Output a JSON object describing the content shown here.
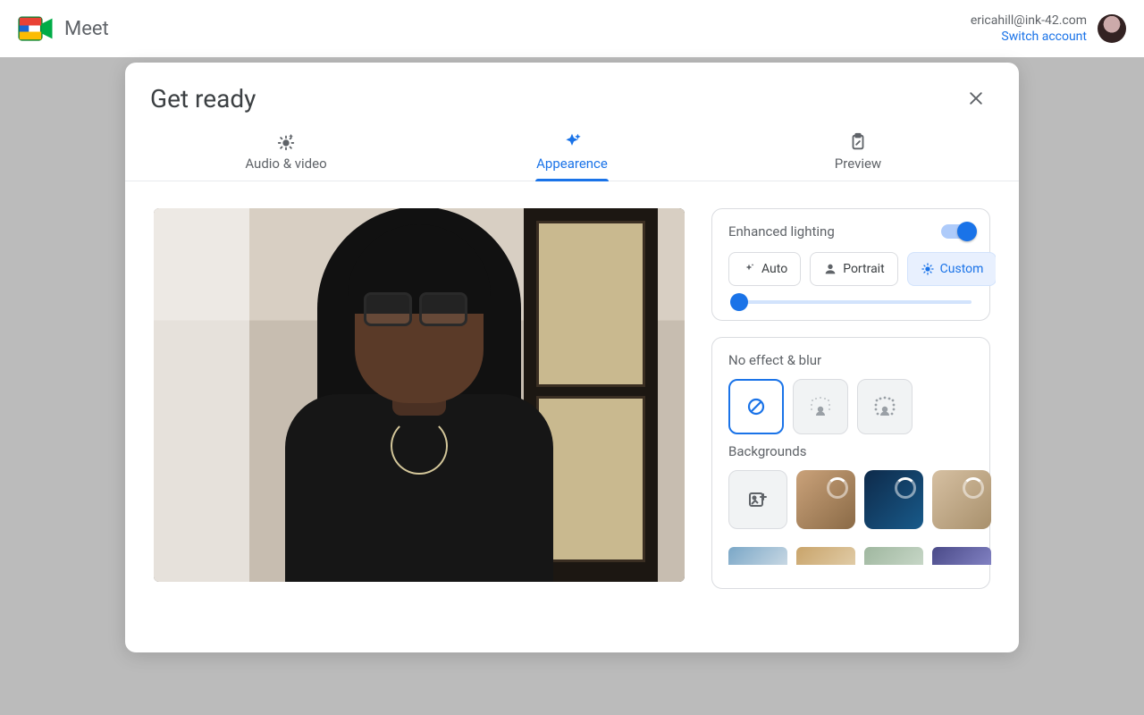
{
  "header": {
    "app_name": "Meet",
    "account_email": "ericahill@ink-42.com",
    "switch_account": "Switch account"
  },
  "modal": {
    "title": "Get ready",
    "tabs": {
      "audio_video": "Audio & video",
      "appearance": "Appearence",
      "preview": "Preview"
    },
    "lighting": {
      "label": "Enhanced lighting",
      "enabled": true,
      "modes": {
        "auto": "Auto",
        "portrait": "Portrait",
        "custom": "Custom"
      },
      "selected_mode": "custom",
      "slider_value": 0
    },
    "effects_section_label": "No effect & blur",
    "backgrounds_label": "Backgrounds"
  },
  "colors": {
    "accent": "#1a73e8",
    "text_muted": "#5f6368",
    "border": "#dadce0"
  }
}
